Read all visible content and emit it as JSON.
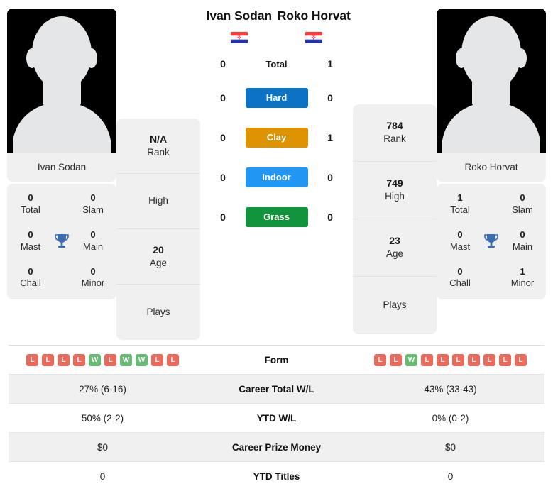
{
  "players": {
    "left": {
      "name": "Ivan Sodan",
      "photo_caption": "Ivan Sodan",
      "country": "Croatia",
      "flag_icon": "croatia-flag-icon",
      "titles": {
        "total_value": "0",
        "total_label": "Total",
        "slam_value": "0",
        "slam_label": "Slam",
        "mast_value": "0",
        "mast_label": "Mast",
        "main_value": "0",
        "main_label": "Main",
        "chall_value": "0",
        "chall_label": "Chall",
        "minor_value": "0",
        "minor_label": "Minor",
        "trophy_icon": "trophy-icon"
      },
      "info": {
        "rank_value": "N/A",
        "rank_label": "Rank",
        "high_value": "",
        "high_label": "High",
        "age_value": "20",
        "age_label": "Age",
        "plays_value": "",
        "plays_label": "Plays"
      },
      "form": [
        "L",
        "L",
        "L",
        "L",
        "W",
        "L",
        "W",
        "W",
        "L",
        "L"
      ]
    },
    "right": {
      "name": "Roko Horvat",
      "photo_caption": "Roko Horvat",
      "country": "Croatia",
      "flag_icon": "croatia-flag-icon",
      "titles": {
        "total_value": "1",
        "total_label": "Total",
        "slam_value": "0",
        "slam_label": "Slam",
        "mast_value": "0",
        "mast_label": "Mast",
        "main_value": "0",
        "main_label": "Main",
        "chall_value": "0",
        "chall_label": "Chall",
        "minor_value": "1",
        "minor_label": "Minor",
        "trophy_icon": "trophy-icon"
      },
      "info": {
        "rank_value": "784",
        "rank_label": "Rank",
        "high_value": "749",
        "high_label": "High",
        "age_value": "23",
        "age_label": "Age",
        "plays_value": "",
        "plays_label": "Plays"
      },
      "form": [
        "L",
        "L",
        "W",
        "L",
        "L",
        "L",
        "L",
        "L",
        "L",
        "L"
      ]
    }
  },
  "h2h": {
    "total": {
      "label": "Total",
      "left": "0",
      "right": "1"
    },
    "surfaces": [
      {
        "label": "Hard",
        "left": "0",
        "right": "0",
        "color": "#0b72c4"
      },
      {
        "label": "Clay",
        "left": "0",
        "right": "1",
        "color": "#de9300"
      },
      {
        "label": "Indoor",
        "left": "0",
        "right": "0",
        "color": "#2196f3"
      },
      {
        "label": "Grass",
        "left": "0",
        "right": "0",
        "color": "#11943c"
      }
    ]
  },
  "stats_rows": [
    {
      "label": "Form",
      "type": "form"
    },
    {
      "label": "Career Total W/L",
      "left": "27% (6-16)",
      "right": "43% (33-43)"
    },
    {
      "label": "YTD W/L",
      "left": "50% (2-2)",
      "right": "0% (0-2)"
    },
    {
      "label": "Career Prize Money",
      "left": "$0",
      "right": "$0"
    },
    {
      "label": "YTD Titles",
      "left": "0",
      "right": "0"
    }
  ],
  "colors": {
    "win": "#68bb75",
    "loss": "#ec6a5c",
    "trophy": "#3b6cb0",
    "card_bg": "#f0f0f0"
  }
}
